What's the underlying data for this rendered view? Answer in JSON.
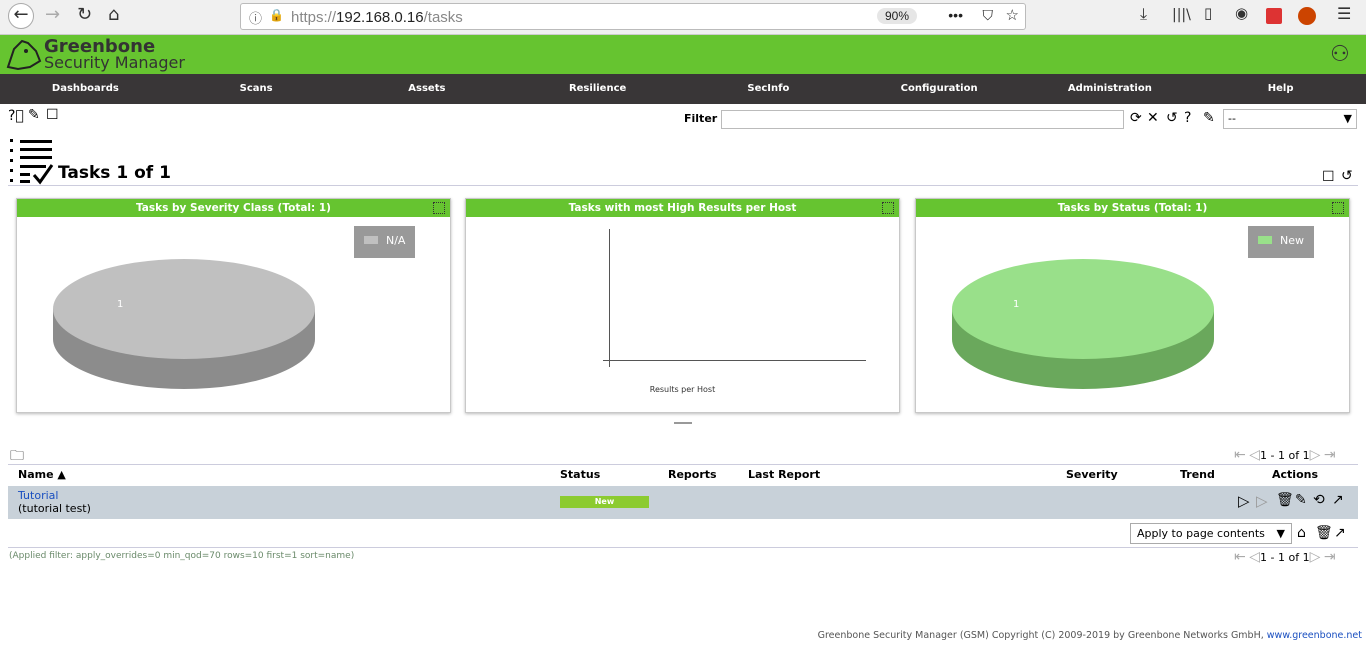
{
  "browser": {
    "url_prefix": "https://",
    "url_host": "192.168.0.16",
    "url_path": "/tasks",
    "zoom": "90%"
  },
  "app": {
    "logo_line1": "Greenbone",
    "logo_line2": "Security Manager"
  },
  "nav": [
    "Dashboards",
    "Scans",
    "Assets",
    "Resilience",
    "SecInfo",
    "Configuration",
    "Administration",
    "Help"
  ],
  "filter": {
    "label": "Filter",
    "value": "",
    "select": "--"
  },
  "page": {
    "title": "Tasks 1 of 1"
  },
  "charts": [
    {
      "title": "Tasks by Severity Class (Total: 1)",
      "legend": "N/A",
      "label": "1",
      "color": "#c0c0c0"
    },
    {
      "title": "Tasks with most High Results per Host",
      "xlabel": "Results per Host"
    },
    {
      "title": "Tasks by Status (Total: 1)",
      "legend": "New",
      "label": "1",
      "color": "#99e08a"
    }
  ],
  "table": {
    "pager": "1 - 1 of 1",
    "headers": {
      "name": "Name ▲",
      "status": "Status",
      "reports": "Reports",
      "last_report": "Last Report",
      "severity": "Severity",
      "trend": "Trend",
      "actions": "Actions"
    },
    "rows": [
      {
        "name": "Tutorial",
        "comment": "(tutorial test)",
        "status": "New"
      }
    ],
    "bulk_action": "Apply to page contents"
  },
  "applied_filter": "(Applied filter: apply_overrides=0 min_qod=70 rows=10 first=1 sort=name)",
  "footer": {
    "text": "Greenbone Security Manager (GSM) Copyright (C) 2009-2019 by Greenbone Networks GmbH, ",
    "link": "www.greenbone.net"
  }
}
